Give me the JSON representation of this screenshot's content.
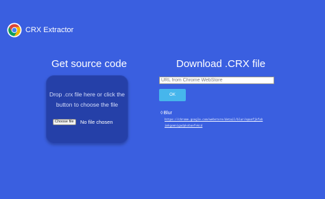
{
  "header": {
    "brand": "CRX Extractor",
    "logo_icon": "chrome-logo-icon"
  },
  "left_panel": {
    "title": "Get source code",
    "drop_text": "Drop .crx file here or click the button to choose the file",
    "choose_file_label": "Choose file",
    "no_file_text": "No file chosen"
  },
  "right_panel": {
    "title": "Download .CRX file",
    "url_placeholder": "URL from Chrome WebStore",
    "ok_label": "OK",
    "result_icon": "diamond-icon",
    "result_name": "Blur",
    "result_url": "https://chrome.google.com/webstore/detail/blur/epanfjkfahimkgomnigadpkobaefekcd"
  },
  "colors": {
    "background": "#3a5fe0",
    "dropzone": "#2540a8",
    "ok_button": "#46b6ec"
  }
}
